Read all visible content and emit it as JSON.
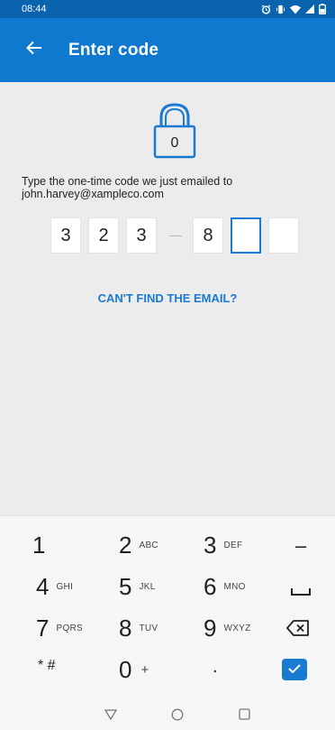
{
  "status_bar": {
    "time": "08:44",
    "icons": [
      "alarm-icon",
      "vibrate-icon",
      "wifi-icon",
      "signal-icon",
      "battery-icon"
    ]
  },
  "app_bar": {
    "title": "Enter code",
    "back_icon": "back-arrow-icon"
  },
  "content": {
    "instruction_line1": "Type the one-time code we just emailed to",
    "instruction_line2": "john.harvey@xampleco.com",
    "code_digits": [
      "3",
      "2",
      "3",
      "8",
      "",
      ""
    ],
    "separator": "—",
    "cant_find_link": "CAN'T FIND THE EMAIL?",
    "lock_digit": "0"
  },
  "keypad": {
    "keys": [
      {
        "num": "1",
        "sub": ""
      },
      {
        "num": "2",
        "sub": "ABC"
      },
      {
        "num": "3",
        "sub": "DEF"
      },
      {
        "num": "4",
        "sub": "GHI"
      },
      {
        "num": "5",
        "sub": "JKL"
      },
      {
        "num": "6",
        "sub": "MNO"
      },
      {
        "num": "7",
        "sub": "PQRS"
      },
      {
        "num": "8",
        "sub": "TUV"
      },
      {
        "num": "9",
        "sub": "WXYZ"
      },
      {
        "num": "0",
        "sub": "+"
      }
    ],
    "minus": "–",
    "star_hash": "* #",
    "dot": ".",
    "accent": "#1a79d0"
  },
  "colors": {
    "status_bar": "#0a63ad",
    "app_bar": "#0f78cf",
    "accent": "#1a79d0"
  }
}
